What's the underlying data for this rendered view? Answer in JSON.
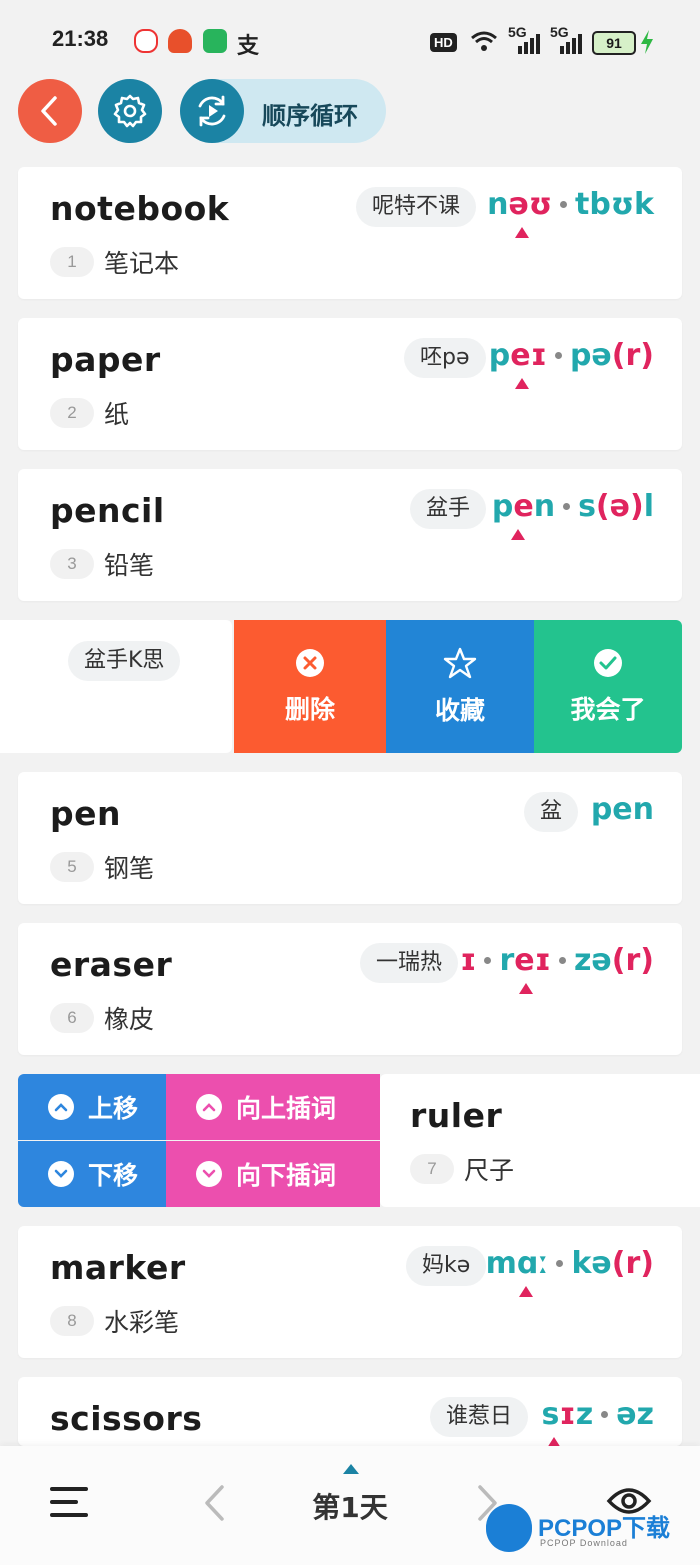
{
  "status_bar": {
    "time": "21:38",
    "hd_label": "HD",
    "signal_label_1": "5G",
    "signal_label_2": "5G",
    "battery": "91"
  },
  "toolbar": {
    "loop_label": "顺序循环"
  },
  "words": [
    {
      "word": "notebook",
      "num": "1",
      "meaning": "笔记本",
      "homophone": "呢特不课",
      "phonetic": [
        {
          "t": "n",
          "c": "t"
        },
        {
          "t": "əʊ",
          "c": "s"
        },
        {
          "t": "•",
          "c": "d"
        },
        {
          "t": "tbʊk",
          "c": "t"
        }
      ]
    },
    {
      "word": "paper",
      "num": "2",
      "meaning": "纸",
      "homophone": "呸pə",
      "phonetic": [
        {
          "t": "p",
          "c": "t"
        },
        {
          "t": "eɪ",
          "c": "s"
        },
        {
          "t": "•",
          "c": "d"
        },
        {
          "t": "pə",
          "c": "t"
        },
        {
          "t": "(r)",
          "c": "s"
        }
      ]
    },
    {
      "word": "pencil",
      "num": "3",
      "meaning": "铅笔",
      "homophone": "盆手",
      "phonetic": [
        {
          "t": "p",
          "c": "t"
        },
        {
          "t": "e",
          "c": "s"
        },
        {
          "t": "n",
          "c": "t"
        },
        {
          "t": "•",
          "c": "d"
        },
        {
          "t": "s",
          "c": "t"
        },
        {
          "t": "(ə)",
          "c": "s"
        },
        {
          "t": "l",
          "c": "t"
        }
      ]
    },
    {
      "word": "pen",
      "num": "5",
      "meaning": "钢笔",
      "homophone": "盆",
      "phonetic": [
        {
          "t": "pen",
          "c": "t"
        }
      ]
    },
    {
      "word": "eraser",
      "num": "6",
      "meaning": "橡皮",
      "homophone": "一瑞热",
      "phonetic": [
        {
          "t": "ɪ",
          "c": "s"
        },
        {
          "t": "•",
          "c": "d"
        },
        {
          "t": "r",
          "c": "t"
        },
        {
          "t": "eɪ",
          "c": "s"
        },
        {
          "t": "•",
          "c": "d"
        },
        {
          "t": "zə",
          "c": "t"
        },
        {
          "t": "(r)",
          "c": "s"
        }
      ]
    },
    {
      "word": "marker",
      "num": "8",
      "meaning": "水彩笔",
      "homophone": "妈kə",
      "phonetic": [
        {
          "t": "mɑː",
          "c": "t"
        },
        {
          "t": "•",
          "c": "d"
        },
        {
          "t": "kə",
          "c": "t"
        },
        {
          "t": "(r)",
          "c": "s"
        }
      ]
    },
    {
      "word": "scissors",
      "num": "",
      "meaning": "",
      "homophone": "谁惹日",
      "phonetic": [
        {
          "t": "s",
          "c": "t"
        },
        {
          "t": "ɪ",
          "c": "s"
        },
        {
          "t": "z",
          "c": "t"
        },
        {
          "t": "•",
          "c": "d"
        },
        {
          "t": "əz",
          "c": "t"
        }
      ]
    }
  ],
  "swipe_row": {
    "homophone": "盆手K思",
    "delete_label": "删除",
    "favorite_label": "收藏",
    "known_label": "我会了"
  },
  "move_row": {
    "move_up": "上移",
    "move_down": "下移",
    "insert_up": "向上插词",
    "insert_down": "向下插词",
    "word": "ruler",
    "num": "7",
    "meaning": "尺子"
  },
  "bottom_bar": {
    "day_label": "第1天"
  },
  "watermark": {
    "brand": "PCPOP下载",
    "sub": "PCPOP Download"
  },
  "colors": {
    "back": "#ef5d44",
    "teal": "#1b83a4",
    "delete": "#fc5b30",
    "favorite": "#2285d6",
    "known": "#23c38e",
    "move": "#2e86de",
    "insert": "#ec4fae",
    "phonetic": "#22a8ad",
    "stress": "#e0245e"
  }
}
